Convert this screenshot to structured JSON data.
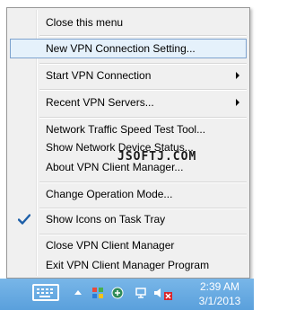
{
  "menu": {
    "items": [
      {
        "label": "Close this menu"
      },
      {
        "label": "New VPN Connection Setting..."
      },
      {
        "label": "Start VPN Connection"
      },
      {
        "label": "Recent VPN Servers..."
      },
      {
        "label": "Network Traffic Speed Test Tool..."
      },
      {
        "label": "Show Network Device Status..."
      },
      {
        "label": "About VPN Client Manager..."
      },
      {
        "label": "Change Operation Mode..."
      },
      {
        "label": "Show Icons on Task Tray",
        "checked": true
      },
      {
        "label": "Close VPN Client Manager"
      },
      {
        "label": "Exit VPN Client Manager Program"
      }
    ],
    "highlight_color": "#e5f1fb",
    "highlight_border": "#7da2ce"
  },
  "watermark": "JSOFTJ.COM",
  "taskbar": {
    "time": "2:39 AM",
    "date": "3/1/2013",
    "color": "#6aaae4"
  }
}
